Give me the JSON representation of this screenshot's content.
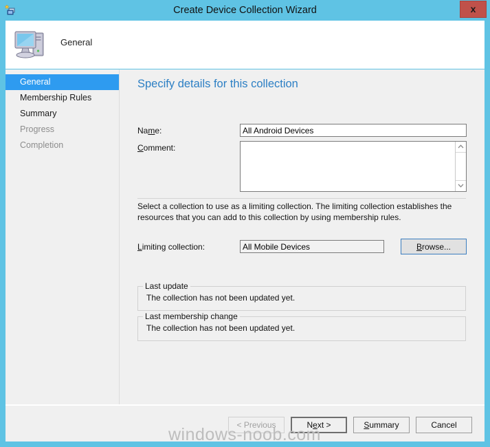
{
  "window": {
    "title": "Create Device Collection Wizard",
    "close_label": "x",
    "title_icon": "collection-wizard-icon"
  },
  "header": {
    "label": "General",
    "icon": "computer-icon"
  },
  "sidebar": {
    "items": [
      {
        "label": "General",
        "state": "selected"
      },
      {
        "label": "Membership Rules",
        "state": "enabled"
      },
      {
        "label": "Summary",
        "state": "enabled"
      },
      {
        "label": "Progress",
        "state": "disabled"
      },
      {
        "label": "Completion",
        "state": "disabled"
      }
    ]
  },
  "content": {
    "heading": "Specify details for this collection",
    "name_label_pre": "Na",
    "name_label_accel": "m",
    "name_label_post": "e:",
    "name_value": "All Android Devices",
    "name_placeholder": "",
    "comment_label_accel": "C",
    "comment_label_post": "omment:",
    "comment_value": "",
    "comment_placeholder": "",
    "help_text": "Select a collection to use as a limiting collection. The limiting collection establishes the resources that you can add to this collection by using membership rules.",
    "limiting_label_accel": "L",
    "limiting_label_post": "imiting collection:",
    "limiting_value": "All Mobile Devices",
    "browse_label_accel": "B",
    "browse_label_post": "rowse...",
    "groups": [
      {
        "title": "Last update",
        "text": "The collection has not been updated yet."
      },
      {
        "title": "Last membership change",
        "text": "The collection has not been updated yet."
      }
    ]
  },
  "footer": {
    "previous_label": "< Previous",
    "next_label_pre": "N",
    "next_label_accel": "e",
    "next_label_post": "xt >",
    "summary_label_accel": "S",
    "summary_label_post": "ummary",
    "cancel_label": "Cancel"
  },
  "watermark": {
    "text": "windows-noob.com"
  },
  "colors": {
    "titlebar": "#5FC3E4",
    "accent_selected": "#2E9BF0",
    "heading": "#2C7FC4",
    "close_button": "#C0514A",
    "panel": "#F0F0F0"
  }
}
